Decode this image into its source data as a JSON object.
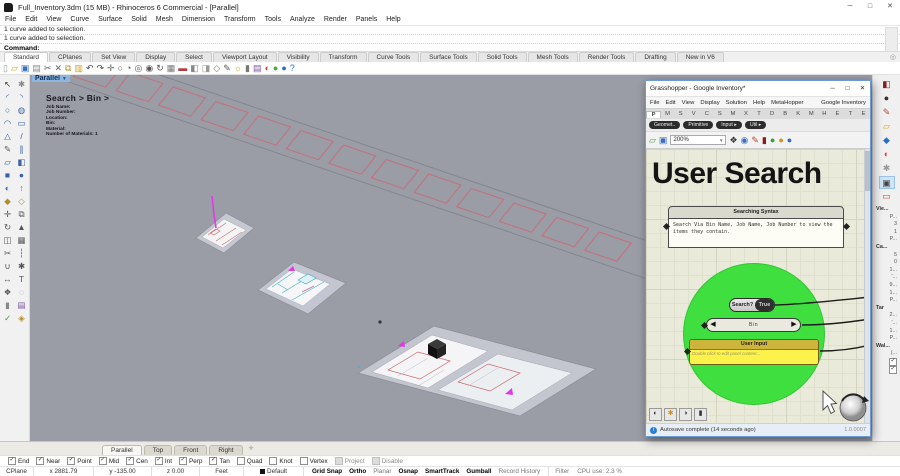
{
  "window": {
    "title": "Full_Inventory.3dm (15 MB) - Rhinoceros 6 Commercial - [Parallel]",
    "minimize": "─",
    "maximize": "□",
    "close": "✕"
  },
  "menu_bar": {
    "items": [
      "File",
      "Edit",
      "View",
      "Curve",
      "Surface",
      "Solid",
      "Mesh",
      "Dimension",
      "Transform",
      "Tools",
      "Analyze",
      "Render",
      "Panels",
      "Help"
    ]
  },
  "command_area": {
    "history": [
      "1 curve added to selection.",
      "1 curve added to selection."
    ],
    "prompt": "Command:"
  },
  "toolbar_tabs": {
    "active_index": 0,
    "items": [
      "Standard",
      "CPlanes",
      "Set View",
      "Display",
      "Select",
      "Viewport Layout",
      "Visibility",
      "Transform",
      "Curve Tools",
      "Surface Tools",
      "Solid Tools",
      "Mesh Tools",
      "Render Tools",
      "Drafting",
      "New in V6"
    ]
  },
  "main_toolbar": {
    "icons": [
      {
        "name": "new-file-icon",
        "glyph": "▯",
        "color": "#9a9a9a"
      },
      {
        "name": "open-file-icon",
        "glyph": "▱",
        "color": "#d9a520"
      },
      {
        "name": "save-icon",
        "glyph": "▣",
        "color": "#3a6fbd"
      },
      {
        "name": "print-icon",
        "glyph": "▤",
        "color": "#888888"
      },
      {
        "name": "cut-icon",
        "glyph": "✂",
        "color": "#666666"
      },
      {
        "name": "delete-icon",
        "glyph": "✕",
        "color": "#666666"
      },
      {
        "name": "copy-icon",
        "glyph": "⧉",
        "color": "#b08f2a"
      },
      {
        "name": "paste-icon",
        "glyph": "▥",
        "color": "#c9a227"
      },
      {
        "name": "undo-icon",
        "glyph": "↶",
        "color": "#444444"
      },
      {
        "name": "redo-icon",
        "glyph": "↷",
        "color": "#444444"
      },
      {
        "name": "pan-icon",
        "glyph": "✛",
        "color": "#666666"
      },
      {
        "name": "zoom-dynamic-icon",
        "glyph": "○",
        "color": "#555555"
      },
      {
        "name": "zoom-window-icon",
        "glyph": "◔",
        "color": "#555555"
      },
      {
        "name": "zoom-extents-icon",
        "glyph": "◎",
        "color": "#555555"
      },
      {
        "name": "zoom-selected-icon",
        "glyph": "◉",
        "color": "#555555"
      },
      {
        "name": "rotate-view-icon",
        "glyph": "↻",
        "color": "#555555"
      },
      {
        "name": "viewport-layout-icon",
        "glyph": "▦",
        "color": "#777777"
      },
      {
        "name": "hide-object-icon",
        "glyph": "▬",
        "color": "#b04040"
      },
      {
        "name": "shaded-view-icon",
        "glyph": "◧",
        "color": "#888888"
      },
      {
        "name": "ghosted-view-icon",
        "glyph": "◨",
        "color": "#999999"
      },
      {
        "name": "wireframe-view-icon",
        "glyph": "◇",
        "color": "#777777"
      },
      {
        "name": "annotate-icon",
        "glyph": "✎",
        "color": "#555555"
      },
      {
        "name": "light-icon",
        "glyph": "☼",
        "color": "#caa520"
      },
      {
        "name": "lock-icon",
        "glyph": "▮",
        "color": "#777777"
      },
      {
        "name": "layers-icon",
        "glyph": "▤",
        "color": "#7a4fa0"
      },
      {
        "name": "color-icon",
        "glyph": "◐",
        "color": "#cc4444"
      },
      {
        "name": "material-icon",
        "glyph": "●",
        "color": "#44aa44"
      },
      {
        "name": "earth-icon",
        "glyph": "●",
        "color": "#2b6fc4"
      },
      {
        "name": "help-icon",
        "glyph": "?",
        "color": "#2b6fc4"
      }
    ]
  },
  "left_toolbar": {
    "icons": [
      {
        "name": "select-tool-icon",
        "glyph": "↖",
        "color": "#444444"
      },
      {
        "name": "point-tool-icon",
        "glyph": "✱",
        "color": "#888888"
      },
      {
        "name": "curve-tool-icon",
        "glyph": "◜",
        "color": "#3b62a8"
      },
      {
        "name": "interpcurve-tool-icon",
        "glyph": "◝",
        "color": "#3b62a8"
      },
      {
        "name": "circle-tool-icon",
        "glyph": "○",
        "color": "#3b62a8"
      },
      {
        "name": "ellipse-tool-icon",
        "glyph": "◍",
        "color": "#3b62a8"
      },
      {
        "name": "arc-tool-icon",
        "glyph": "◠",
        "color": "#3b62a8"
      },
      {
        "name": "rectangle-tool-icon",
        "glyph": "▭",
        "color": "#3b62a8"
      },
      {
        "name": "polygon-tool-icon",
        "glyph": "△",
        "color": "#3b62a8"
      },
      {
        "name": "line-tool-icon",
        "glyph": "/",
        "color": "#3b62a8"
      },
      {
        "name": "freeform-tool-icon",
        "glyph": "✎",
        "color": "#555555"
      },
      {
        "name": "offset-tool-icon",
        "glyph": "∥",
        "color": "#3b62a8"
      },
      {
        "name": "surface-tool-icon",
        "glyph": "▱",
        "color": "#3b62a8"
      },
      {
        "name": "loft-tool-icon",
        "glyph": "◧",
        "color": "#3b62a8"
      },
      {
        "name": "box-tool-icon",
        "glyph": "■",
        "color": "#3b62a8"
      },
      {
        "name": "sphere-tool-icon",
        "glyph": "●",
        "color": "#3b62a8"
      },
      {
        "name": "boolean-tool-icon",
        "glyph": "◐",
        "color": "#3b62a8"
      },
      {
        "name": "extrude-tool-icon",
        "glyph": "↑",
        "color": "#3b62a8"
      },
      {
        "name": "fillet-tool-icon",
        "glyph": "◆",
        "color": "#b58b2a"
      },
      {
        "name": "chamfer-tool-icon",
        "glyph": "◇",
        "color": "#b58b2a"
      },
      {
        "name": "move-tool-icon",
        "glyph": "✛",
        "color": "#555555"
      },
      {
        "name": "copy-tool-icon",
        "glyph": "⧉",
        "color": "#555555"
      },
      {
        "name": "rotate-tool-icon",
        "glyph": "↻",
        "color": "#555555"
      },
      {
        "name": "scale-tool-icon",
        "glyph": "▲",
        "color": "#555555"
      },
      {
        "name": "mirror-tool-icon",
        "glyph": "◫",
        "color": "#555555"
      },
      {
        "name": "array-tool-icon",
        "glyph": "▦",
        "color": "#555555"
      },
      {
        "name": "trim-tool-icon",
        "glyph": "✂",
        "color": "#555555"
      },
      {
        "name": "split-tool-icon",
        "glyph": "┆",
        "color": "#555555"
      },
      {
        "name": "join-tool-icon",
        "glyph": "∪",
        "color": "#555555"
      },
      {
        "name": "explode-tool-icon",
        "glyph": "✱",
        "color": "#555555"
      },
      {
        "name": "dimension-tool-icon",
        "glyph": "↔",
        "color": "#555555"
      },
      {
        "name": "text-tool-icon",
        "glyph": "T",
        "color": "#555555"
      },
      {
        "name": "group-tool-icon",
        "glyph": "❖",
        "color": "#555555"
      },
      {
        "name": "hide-tool-icon",
        "glyph": "◌",
        "color": "#888888"
      },
      {
        "name": "lock-tool-icon",
        "glyph": "▮",
        "color": "#888888"
      },
      {
        "name": "layer-tool-icon",
        "glyph": "▤",
        "color": "#7a4fa0"
      },
      {
        "name": "check-tool-icon",
        "glyph": "✓",
        "color": "#3f9e3f"
      },
      {
        "name": "misc-tool-icon",
        "glyph": "◈",
        "color": "#b58b2a"
      }
    ]
  },
  "viewport": {
    "label": "Parallel",
    "overlay": {
      "title": "Search > Bin >",
      "lines": [
        "Job Name:",
        "Job Number:",
        "Location:",
        "Bin:",
        "Material:",
        "Number of Materials: 1"
      ]
    }
  },
  "right_dock": {
    "icons": [
      {
        "name": "properties-panel-icon",
        "glyph": "◧",
        "color": "#8b1a1a",
        "selected": false
      },
      {
        "name": "render-panel-icon",
        "glyph": "●",
        "color": "#333333",
        "selected": false
      },
      {
        "name": "brush-panel-icon",
        "glyph": "✎",
        "color": "#b5452a",
        "selected": false
      },
      {
        "name": "libraries-panel-icon",
        "glyph": "▱",
        "color": "#d9a520",
        "selected": false
      },
      {
        "name": "notifications-panel-icon",
        "glyph": "◆",
        "color": "#2b6fc4",
        "selected": false
      },
      {
        "name": "display-panel-icon",
        "glyph": "◐",
        "color": "#cc4444",
        "selected": false
      },
      {
        "name": "settings-panel-icon",
        "glyph": "✱",
        "color": "#999999",
        "selected": false
      },
      {
        "name": "camera-panel-icon",
        "glyph": "▣",
        "color": "#444444",
        "selected": true
      },
      {
        "name": "wallpaper-panel-icon",
        "glyph": "▭",
        "color": "#cc4444",
        "selected": false
      }
    ],
    "props": [
      {
        "text": "Vie...",
        "kind": "header"
      },
      {
        "text": "P...",
        "kind": "value"
      },
      {
        "text": "3",
        "kind": "value"
      },
      {
        "text": "1",
        "kind": "value"
      },
      {
        "text": "P...",
        "kind": "value"
      },
      {
        "text": "Ca...",
        "kind": "header"
      },
      {
        "text": "5",
        "kind": "value"
      },
      {
        "text": "0",
        "kind": "value"
      },
      {
        "text": "1...",
        "kind": "value"
      },
      {
        "text": "'...",
        "kind": "value"
      },
      {
        "text": "9...",
        "kind": "value"
      },
      {
        "text": "1...",
        "kind": "value"
      },
      {
        "text": "P...",
        "kind": "value"
      },
      {
        "text": "Tar",
        "kind": "header"
      },
      {
        "text": "2...",
        "kind": "value"
      },
      {
        "text": "'...",
        "kind": "value"
      },
      {
        "text": "1...",
        "kind": "value"
      },
      {
        "text": "P...",
        "kind": "value"
      },
      {
        "text": "Wal...",
        "kind": "header"
      },
      {
        "text": "(...",
        "kind": "value"
      },
      {
        "text": "",
        "kind": "check"
      },
      {
        "text": "",
        "kind": "check"
      }
    ]
  },
  "grasshopper": {
    "title": "Grasshopper - Google Inventory*",
    "controls": {
      "minimize": "─",
      "maximize": "□",
      "close": "✕"
    },
    "menu": {
      "items": [
        "File",
        "Edit",
        "View",
        "Display",
        "Solution",
        "Help",
        "MetaHopper"
      ],
      "right_item": "Google Inventory"
    },
    "component_tabs": {
      "active_index": 0,
      "letters": [
        "P",
        "M",
        "S",
        "V",
        "C",
        "S",
        "M",
        "X",
        "T",
        "D",
        "B",
        "K",
        "M",
        "H",
        "E",
        "T",
        "E"
      ]
    },
    "subcategories": [
      "Geomet..",
      "Primitive",
      "Input ▸",
      "Util ▸"
    ],
    "toolbar": {
      "file_icons": [
        {
          "name": "gh-open-definition-icon",
          "glyph": "▱",
          "color": "#4aa34a"
        },
        {
          "name": "gh-save-definition-icon",
          "glyph": "▣",
          "color": "#3a6fbd"
        }
      ],
      "zoom_value": "200%",
      "view_icons": [
        {
          "name": "gh-zoom-extents-icon",
          "glyph": "❖",
          "color": "#333333"
        },
        {
          "name": "gh-preview-eye-icon",
          "glyph": "◉",
          "color": "#3a6fbd"
        },
        {
          "name": "gh-sketch-icon",
          "glyph": "✎",
          "color": "#b5452a"
        },
        {
          "name": "gh-material-book-icon",
          "glyph": "▮",
          "color": "#8b1a1a"
        },
        {
          "name": "gh-mesh-green-icon",
          "glyph": "●",
          "color": "#3f9e3f"
        },
        {
          "name": "gh-mesh-orange-icon",
          "glyph": "●",
          "color": "#d2901f"
        },
        {
          "name": "gh-mesh-blue-icon",
          "glyph": "●",
          "color": "#2b6fc4"
        }
      ]
    },
    "canvas": {
      "title": "User Search",
      "group": {
        "header": "Searching Syntax",
        "body": "Search Via Bin Name, Job Name, Job Number to view the items they contain."
      },
      "toggle": {
        "label": "Search?",
        "value": "True"
      },
      "value_list": {
        "label": "Bin"
      },
      "panel": {
        "header": "User Input",
        "hint": "Double click to edit panel content…"
      }
    },
    "bottom_icons": [
      {
        "name": "gh-preview-toggle-icon",
        "glyph": "◐",
        "color": "#333333"
      },
      {
        "name": "gh-solver-icon",
        "glyph": "✱",
        "color": "#d2901f"
      },
      {
        "name": "gh-wire-display-icon",
        "glyph": "◑",
        "color": "#333333"
      },
      {
        "name": "gh-canvas-settings-icon",
        "glyph": "▮",
        "color": "#333333"
      }
    ],
    "status_bar": {
      "message": "Autosave complete (14 seconds ago)",
      "version": "1.0.0007"
    }
  },
  "viewport_tabs": {
    "items": [
      {
        "label": "Parallel",
        "active": true
      },
      {
        "label": "Top",
        "active": false
      },
      {
        "label": "Front",
        "active": false
      },
      {
        "label": "Right",
        "active": false
      }
    ]
  },
  "osnap": {
    "items": [
      {
        "label": "End",
        "checked": true
      },
      {
        "label": "Near",
        "checked": true
      },
      {
        "label": "Point",
        "checked": true
      },
      {
        "label": "Mid",
        "checked": true
      },
      {
        "label": "Cen",
        "checked": true
      },
      {
        "label": "Int",
        "checked": true
      },
      {
        "label": "Perp",
        "checked": true
      },
      {
        "label": "Tan",
        "checked": true
      },
      {
        "label": "Quad",
        "checked": false
      },
      {
        "label": "Knot",
        "checked": false
      },
      {
        "label": "Vertex",
        "checked": false
      }
    ],
    "disabled_items": [
      "Project",
      "Disable"
    ]
  },
  "status_bar": {
    "cplane": "CPlane",
    "x": "x 2881.79",
    "y": "y -135.00",
    "z": "z 0.00",
    "units": "Feet",
    "layer": "Default",
    "toggles": [
      {
        "label": "Grid Snap",
        "bold": true
      },
      {
        "label": "Ortho",
        "bold": true
      },
      {
        "label": "Planar",
        "bold": false
      },
      {
        "label": "Osnap",
        "bold": true
      },
      {
        "label": "SmartTrack",
        "bold": true
      },
      {
        "label": "Gumball",
        "bold": true
      },
      {
        "label": "Record History",
        "bold": false
      }
    ],
    "filter": "Filter",
    "cpu": "CPU use: 2.3 %"
  }
}
